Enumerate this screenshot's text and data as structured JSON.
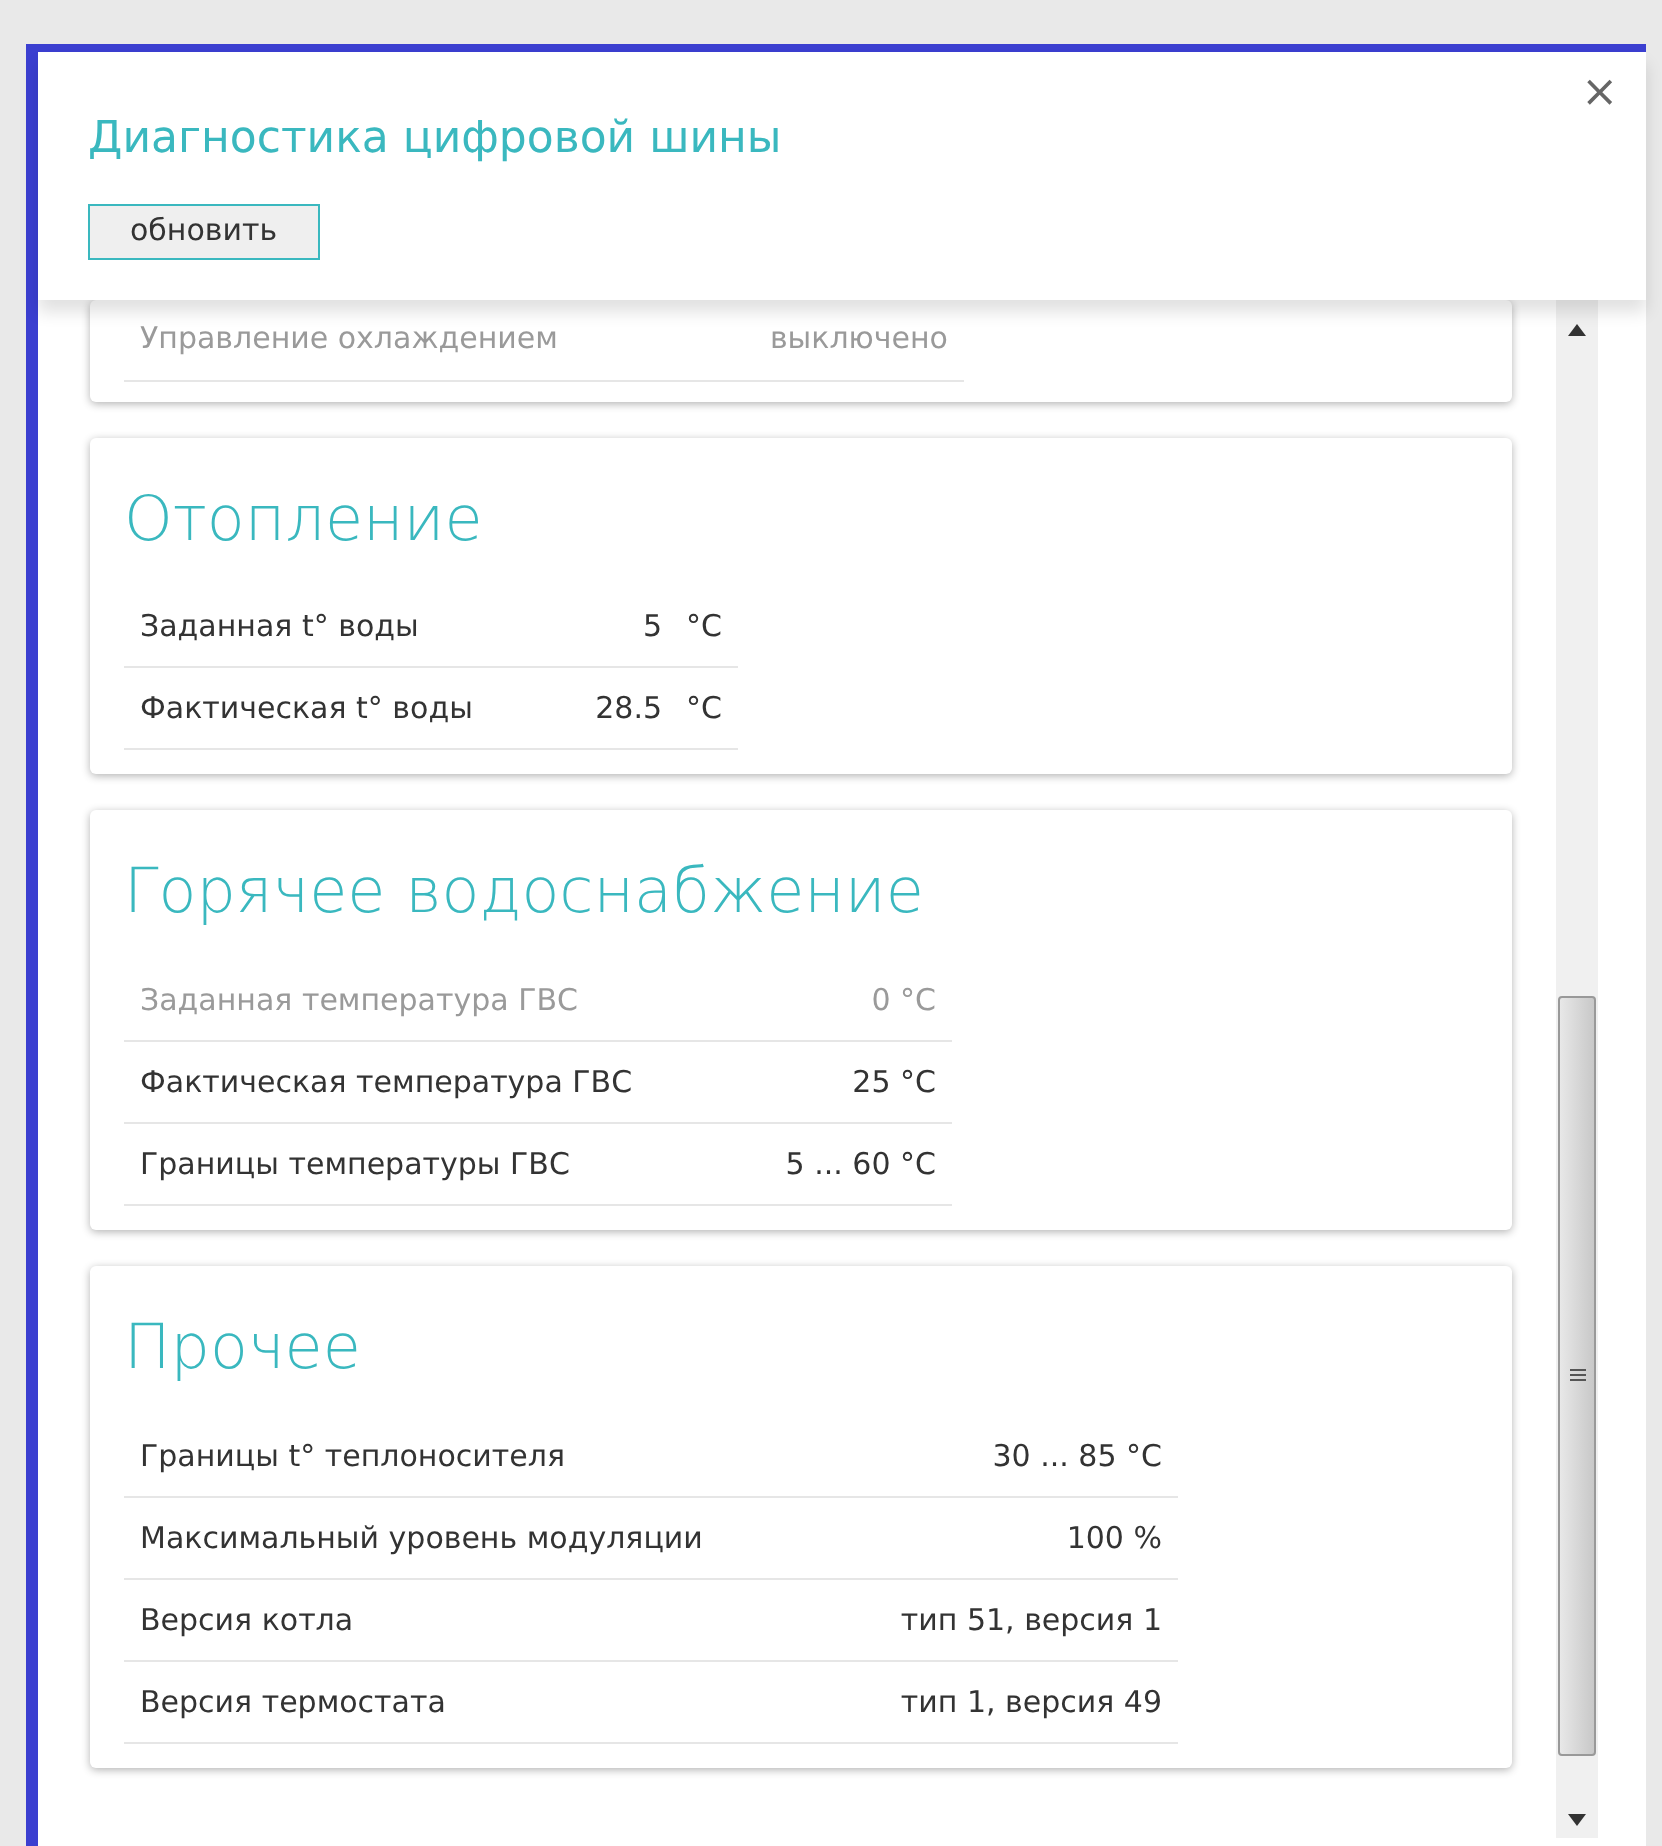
{
  "dialog": {
    "title": "Диагностика цифровой шины",
    "close": "×",
    "refresh_button": "обновить"
  },
  "sections": [
    {
      "rows": [
        {
          "label": "Управление охлаждением",
          "value": "выключено",
          "disabled": true
        }
      ]
    },
    {
      "title": "Отопление",
      "rows": [
        {
          "label": "Заданная t° воды",
          "value": "5",
          "unit": "°C",
          "disabled": false
        },
        {
          "label": "Фактическая t° воды",
          "value": "28.5",
          "unit": "°C",
          "disabled": false
        }
      ]
    },
    {
      "title": "Горячее водоснабжение",
      "rows": [
        {
          "label": "Заданная температура ГВС",
          "value": "0 °C",
          "disabled": true
        },
        {
          "label": "Фактическая температура ГВС",
          "value": "25 °C",
          "disabled": false
        },
        {
          "label": "Границы температуры ГВС",
          "value": "5 ... 60 °C",
          "disabled": false
        }
      ]
    },
    {
      "title": "Прочее",
      "rows": [
        {
          "label": "Границы t° теплоносителя",
          "value": "30 ... 85 °C",
          "disabled": false
        },
        {
          "label": "Максимальный уровень модуляции",
          "value": "100 %",
          "disabled": false
        },
        {
          "label": "Версия котла",
          "value": "тип 51, версия 1",
          "disabled": false
        },
        {
          "label": "Версия термостата",
          "value": "тип 1, версия 49",
          "disabled": false
        }
      ]
    }
  ]
}
